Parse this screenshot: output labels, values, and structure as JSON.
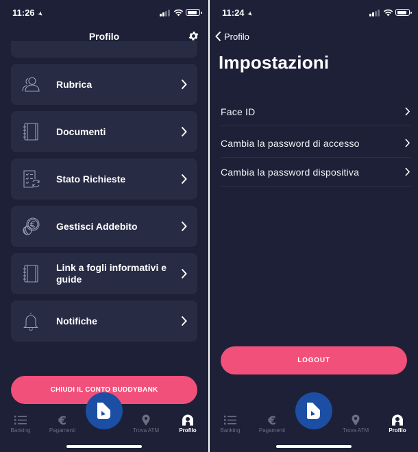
{
  "left": {
    "status": {
      "time": "11:26"
    },
    "header": {
      "title": "Profilo"
    },
    "menu": [
      {
        "label": "Rubrica",
        "icon": "contacts-icon"
      },
      {
        "label": "Documenti",
        "icon": "notebook-icon"
      },
      {
        "label": "Stato Richieste",
        "icon": "checklist-refresh-icon"
      },
      {
        "label": "Gestisci Addebito",
        "icon": "euro-coins-icon"
      },
      {
        "label": "Link a fogli informativi e guide",
        "icon": "notebook-icon"
      },
      {
        "label": "Notifiche",
        "icon": "bell-icon"
      }
    ],
    "close_button": "CHIUDI IL CONTO BUDDYBANK",
    "tabs": [
      {
        "label": "Banking",
        "icon": "list-icon"
      },
      {
        "label": "Pagamenti",
        "icon": "euro-icon"
      },
      {
        "label": "Trova ATM",
        "icon": "map-pin-icon"
      },
      {
        "label": "Profilo",
        "icon": "profile-icon",
        "active": true
      }
    ]
  },
  "right": {
    "status": {
      "time": "11:24"
    },
    "back_label": "Profilo",
    "title": "Impostazioni",
    "settings": [
      {
        "label": "Face ID"
      },
      {
        "label": "Cambia la password di accesso"
      },
      {
        "label": "Cambia la password dispositiva"
      }
    ],
    "logout_button": "LOGOUT",
    "tabs": [
      {
        "label": "Banking",
        "icon": "list-icon"
      },
      {
        "label": "Pagamenti",
        "icon": "euro-icon"
      },
      {
        "label": "Trova ATM",
        "icon": "map-pin-icon"
      },
      {
        "label": "Profilo",
        "icon": "profile-icon",
        "active": true
      }
    ]
  },
  "colors": {
    "background": "#1d2037",
    "card": "#272b44",
    "accent_pink": "#f0507a",
    "fab_blue": "#1c4fa4",
    "tab_inactive": "#6a6e83"
  }
}
